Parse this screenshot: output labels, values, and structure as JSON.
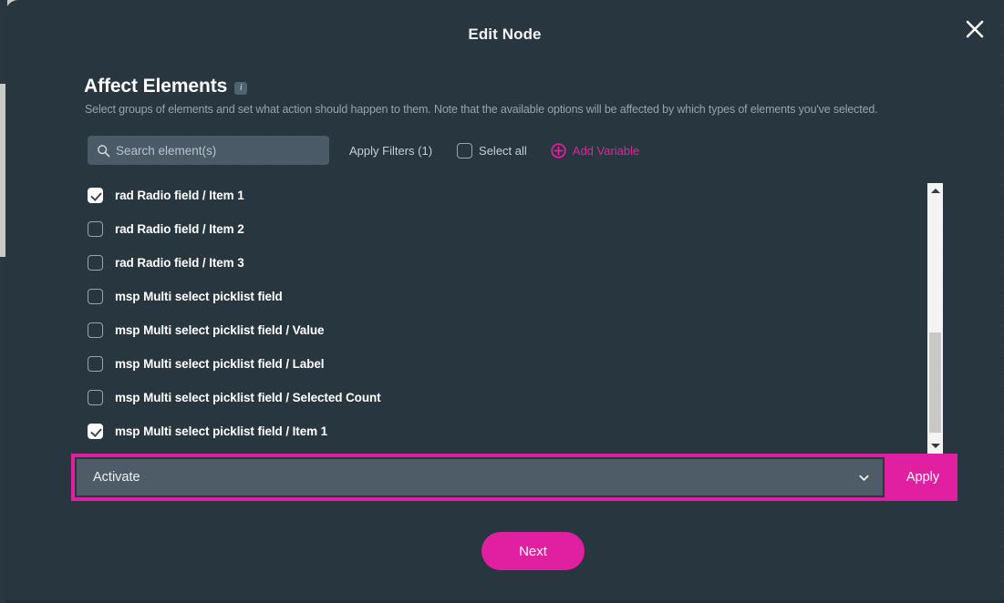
{
  "modal": {
    "title": "Edit Node",
    "close_icon": "close-icon"
  },
  "section": {
    "heading": "Affect Elements",
    "info_icon_label": "i",
    "description": "Select groups of elements and set what action should happen to them. Note that the available options will be affected by which types of elements you've selected."
  },
  "controls": {
    "search_placeholder": "Search element(s)",
    "search_value": "",
    "search_icon": "search-icon",
    "apply_filters_label": "Apply Filters (1)",
    "select_all_label": "Select all",
    "select_all_checked": false,
    "add_variable_label": "Add Variable",
    "add_variable_icon": "plus-circle-icon"
  },
  "element_list": {
    "items": [
      {
        "label": "rad Radio field / Item 1",
        "checked": true
      },
      {
        "label": "rad Radio field / Item 2",
        "checked": false
      },
      {
        "label": "rad Radio field / Item 3",
        "checked": false
      },
      {
        "label": "msp Multi select picklist field",
        "checked": false
      },
      {
        "label": "msp Multi select picklist field / Value",
        "checked": false
      },
      {
        "label": "msp Multi select picklist field / Label",
        "checked": false
      },
      {
        "label": "msp Multi select picklist field / Selected Count",
        "checked": false
      },
      {
        "label": "msp Multi select picklist field / Item 1",
        "checked": true
      }
    ]
  },
  "scrollbar": {
    "up_arrow_icon": "triangle-up-icon",
    "down_arrow_icon": "triangle-down-icon"
  },
  "action": {
    "select_value": "Activate",
    "select_chevron_icon": "chevron-down-icon",
    "apply_label": "Apply"
  },
  "footer": {
    "next_label": "Next"
  },
  "colors": {
    "accent": "#e01fa1",
    "panel": "#283640",
    "input": "#4a5a66",
    "select": "#4d5c66",
    "text": "#ffffff",
    "muted_text": "#97a4ad"
  }
}
